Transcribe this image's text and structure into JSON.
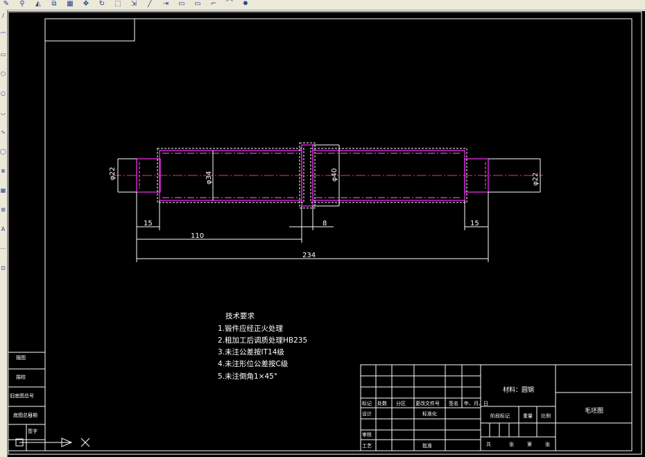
{
  "toolbar": {
    "icons": [
      "pencil-icon",
      "link-icon",
      "mirror-icon",
      "offset-icon",
      "array-icon",
      "move-icon",
      "rotate-icon",
      "scale-icon",
      "stretch-icon",
      "trim-icon",
      "extend-icon",
      "break-icon",
      "join-icon",
      "chamfer-icon",
      "fillet-icon",
      "explode-icon"
    ],
    "glyphs": [
      "✎",
      "⚲",
      "◭",
      "⧉",
      "▦",
      "✥",
      "↻",
      "⬚",
      "⇲",
      "╱",
      "⇥",
      "▭",
      "▭",
      "⌐",
      "⌒",
      "✹"
    ]
  },
  "left_toolbar": {
    "glyphs": [
      "∕",
      "⌒",
      "▭",
      "⬡",
      "○",
      "◡",
      "∿",
      "◯",
      "⊕",
      "▦",
      "⊞",
      "A",
      "⋯",
      "⊡"
    ]
  },
  "drawing": {
    "colors": {
      "outline": "#ffffff",
      "part": "#ff33ff",
      "centerline": "#ff3333",
      "text": "#ffffff"
    },
    "dimensions": {
      "dia_left": "φ22",
      "dia_body": "φ34",
      "dia_collar": "φ40",
      "dia_right": "φ22",
      "len_left": "15",
      "len_110": "110",
      "len_collar": "8",
      "len_right": "15",
      "len_total": "234"
    },
    "tech_req": {
      "title": "技术要求",
      "items": [
        "1.锻件应经正火处理",
        "2.粗加工后调质处理HB235",
        "3.未注公差按IT14级",
        "4.未注形位公差按C级",
        "5.未注倒角1×45°"
      ]
    },
    "title_block": {
      "material": "材料：圆钢",
      "drawing_name": "毛坯图",
      "header_row": [
        "标记",
        "处数",
        "分区",
        "更改文件号",
        "签名",
        "年、月、日"
      ],
      "row_design": "设计",
      "row_standard": "标准化",
      "row_check": "审核",
      "row_process": "工艺",
      "row_approve": "批准",
      "stage_mark": "阶段标记",
      "weight": "重量",
      "scale": "比例",
      "sheets": [
        "共",
        "张",
        "第",
        "张"
      ]
    },
    "left_column": [
      "描图",
      "描校",
      "旧底图总号",
      "底图总号",
      "日期",
      "签字"
    ]
  }
}
